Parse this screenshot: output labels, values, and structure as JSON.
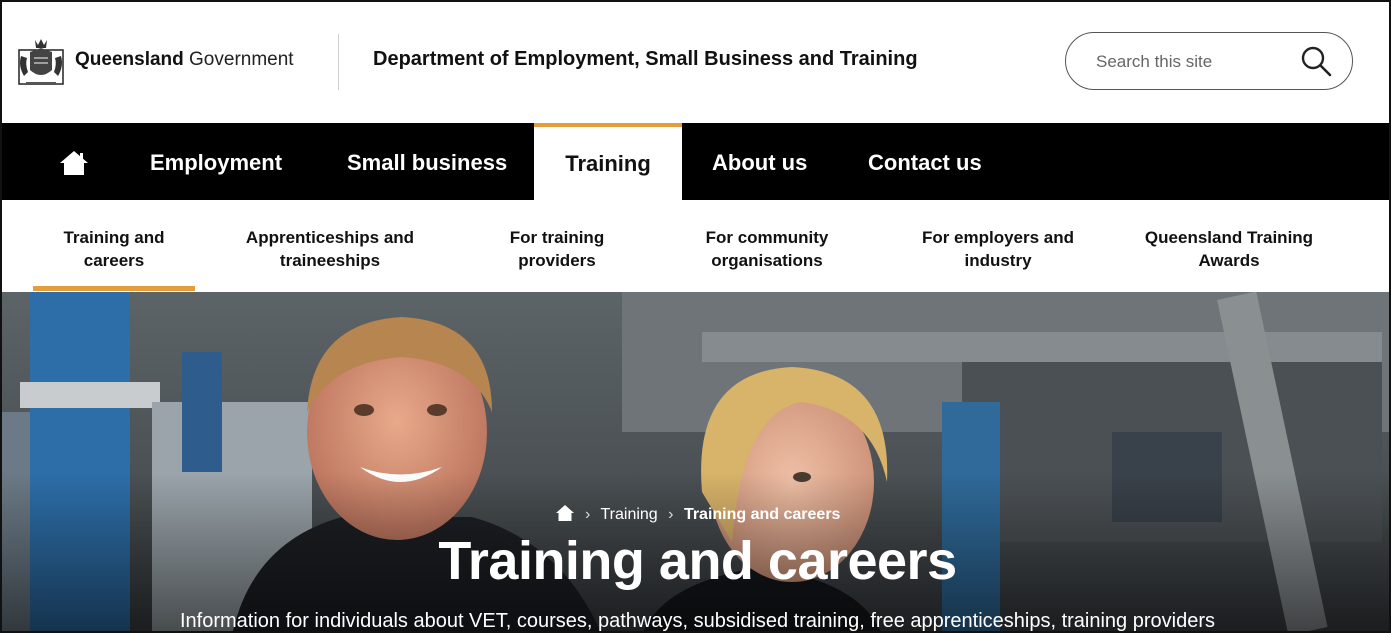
{
  "header": {
    "org_bold": "Queensland",
    "org_regular": "Government",
    "department": "Department of Employment, Small Business and Training",
    "search_placeholder": "Search this site",
    "search_icon": "search-icon",
    "crest_icon": "queensland-crest-icon"
  },
  "main_nav": {
    "home_icon": "home-icon",
    "items": [
      {
        "label": "Employment"
      },
      {
        "label": "Small business"
      },
      {
        "label": "Training",
        "active": true
      },
      {
        "label": "About us"
      },
      {
        "label": "Contact us"
      }
    ]
  },
  "sub_nav": {
    "items": [
      {
        "line1": "Training and",
        "line2": "careers",
        "active": true
      },
      {
        "line1": "Apprenticeships and",
        "line2": "traineeships"
      },
      {
        "line1": "For training",
        "line2": "providers"
      },
      {
        "line1": "For community",
        "line2": "organisations"
      },
      {
        "line1": "For employers and",
        "line2": "industry"
      },
      {
        "line1": "Queensland Training",
        "line2": "Awards"
      }
    ]
  },
  "hero": {
    "breadcrumb": {
      "home_icon": "home-icon",
      "items": [
        "Training",
        "Training and careers"
      ]
    },
    "title": "Training and careers",
    "description": "Information for individuals about VET, courses, pathways, subsidised training, free apprenticeships, training providers"
  },
  "colors": {
    "accent": "#e39d3b",
    "nav_background": "#000000",
    "text": "#111111"
  }
}
